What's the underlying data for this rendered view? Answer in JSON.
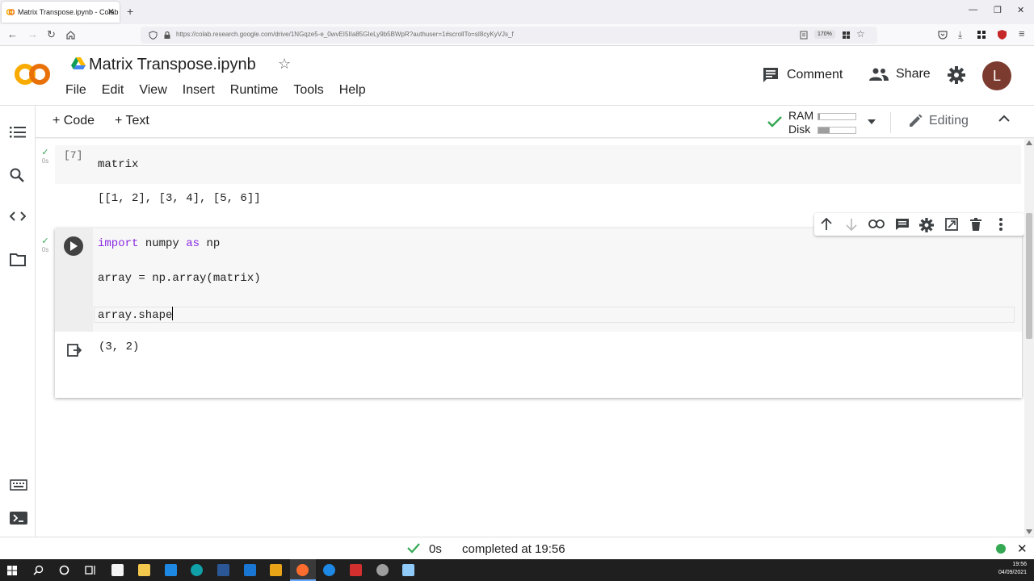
{
  "browser": {
    "tab_title": "Matrix Transpose.ipynb - Colab",
    "tab_close": "✕",
    "new_tab": "+",
    "url": "https://colab.research.google.com/drive/1NGqze5-e_0wvEI5IIa85GIeLy9b5BWpR?authuser=1#scrollTo=sI8cyKyVJs_f",
    "zoom": "170%"
  },
  "header": {
    "logo": "CO",
    "notebook_title": "Matrix Transpose.ipynb",
    "menu": [
      "File",
      "Edit",
      "View",
      "Insert",
      "Runtime",
      "Tools",
      "Help"
    ],
    "comment_label": "Comment",
    "share_label": "Share",
    "avatar_letter": "L"
  },
  "toolbar": {
    "add_code": "+ Code",
    "add_text": "+ Text",
    "ram_label": "RAM",
    "disk_label": "Disk",
    "ram_usage": 0.05,
    "disk_usage": 0.3,
    "editing_label": "Editing"
  },
  "cells": [
    {
      "exec_count": "[7]",
      "duration": "0s",
      "code": "matrix",
      "output": "[[1, 2], [3, 4], [5, 6]]"
    },
    {
      "duration": "0s",
      "code_lines": [
        {
          "kw1": "import",
          "mid": " numpy ",
          "kw2": "as",
          "end": " np"
        },
        {
          "text": "array = np.array(matrix)"
        },
        {
          "text": "array.shape"
        }
      ],
      "output": "(3, 2)"
    }
  ],
  "status": {
    "duration": "0s",
    "message": "completed at 19:56"
  },
  "taskbar": {
    "time": "19:56",
    "date": "04/09/2021"
  },
  "colors": {
    "check_green": "#34a853",
    "logo_orange": "#f9ab00",
    "keyword_purple": "#8a2be2"
  }
}
